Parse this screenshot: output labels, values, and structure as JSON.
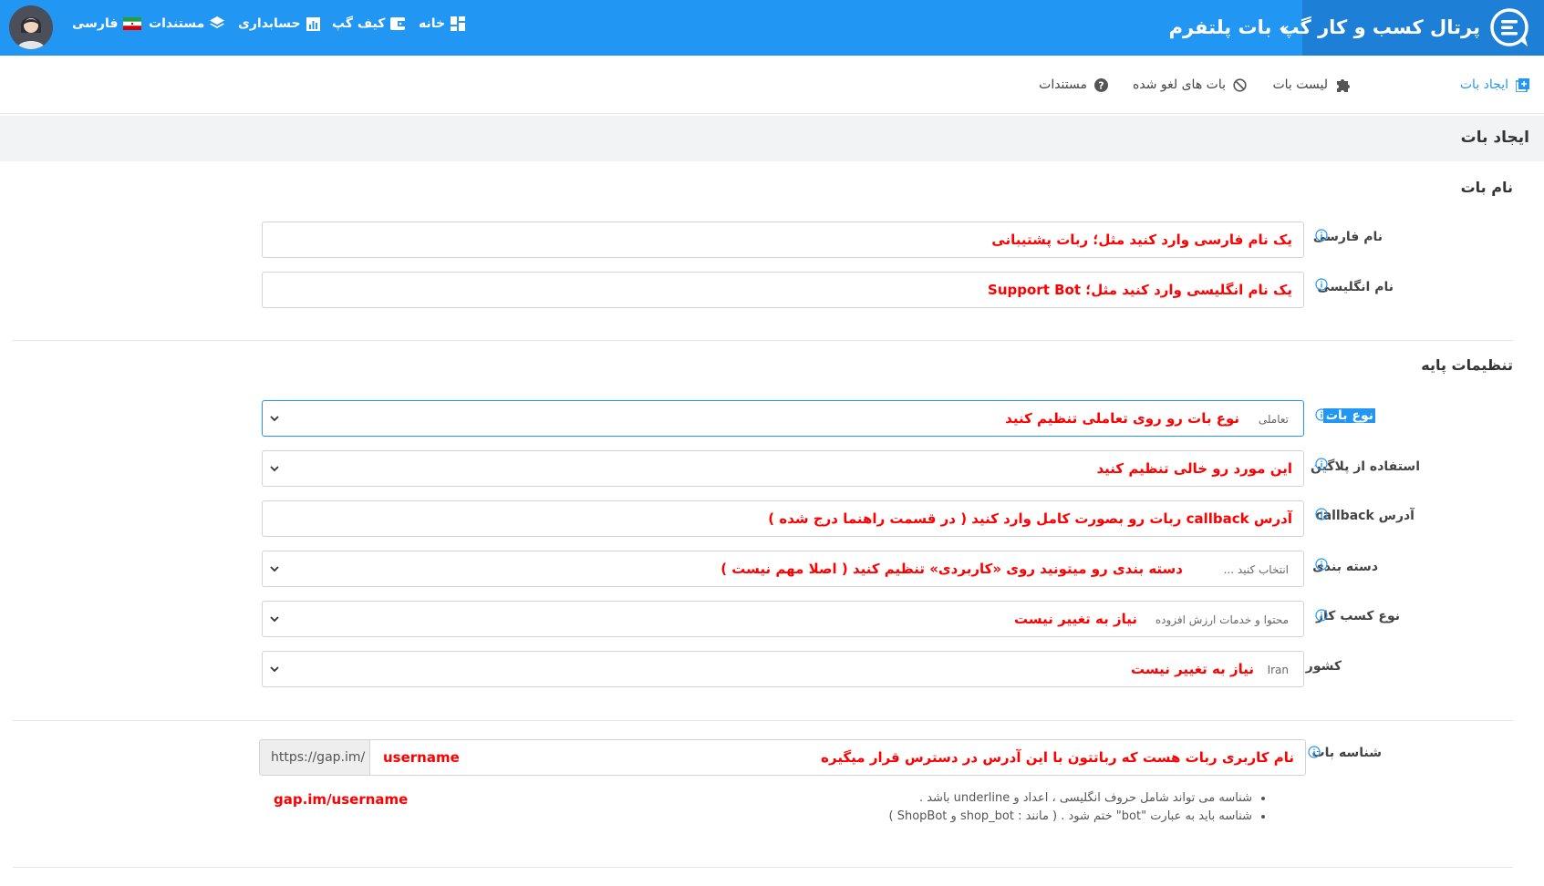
{
  "header": {
    "brand": "پرتال کسب و کار گپ",
    "page_title": "بات پلتفرم",
    "chevron": "»",
    "nav": [
      {
        "label": "خانه",
        "icon": "dashboard-icon"
      },
      {
        "label": "کیف گپ",
        "icon": "wallet-icon"
      },
      {
        "label": "حسابداری",
        "icon": "chart-icon"
      },
      {
        "label": "مستندات",
        "icon": "layers-icon"
      },
      {
        "label": "فارسی",
        "icon": "iran-flag-icon"
      }
    ],
    "accent": "#2196f3"
  },
  "subnav": {
    "tabs": [
      {
        "label": "ایجاد بات",
        "icon": "add-box-icon",
        "active": true
      },
      {
        "label": "لیست بات",
        "icon": "puzzle-icon",
        "active": false
      },
      {
        "label": "بات های لغو شده",
        "icon": "block-icon",
        "active": false
      },
      {
        "label": "مستندات",
        "icon": "help-icon",
        "active": false
      }
    ]
  },
  "section_title": "ایجاد بات",
  "bot_name": {
    "title": "نام بات",
    "persian_label": "نام فارسی",
    "persian_hint": "یک نام فارسی وارد کنید مثل؛ ربات پشتیبانی",
    "english_label": "نام انگلیسی",
    "english_hint": "یک نام انگلیسی وارد کنید مثل؛ Support Bot"
  },
  "basic": {
    "title": "تنظیمات پایه",
    "type_label": "نوع بات",
    "type_value": "تعاملی",
    "type_hint": "نوع بات رو روی  تعاملی تنظیم کنید",
    "plugin_label": "استفاده از پلاگین",
    "plugin_hint": "این مورد رو خالی تنظیم کنید",
    "callback_label": "آدرس callback",
    "callback_hint": "آدرس callback ربات رو بصورت کامل وارد کنید ( در قسمت راهنما درج شده )",
    "category_label": "دسته بندی",
    "category_value": "انتخاب کنید ...",
    "category_hint": "دسته بندی رو میتونید روی «کاربردی» تنظیم کنید ( اصلا مهم نیست )",
    "business_label": "نوع کسب کار",
    "business_value": "محتوا و خدمات ارزش افزوده",
    "business_hint": "نیاز به تغییر نیست",
    "country_label": "کشور",
    "country_value": "Iran",
    "country_hint": "نیاز به تغییر نیست"
  },
  "bot_id": {
    "label": "شناسه بات",
    "prefix": "https://gap.im/",
    "hint_right": "نام کاربری ربات هست که رباتتون با این آدرس در دسترس قرار میگیره",
    "hint_left": "username",
    "rules": [
      "شناسه می تواند شامل حروف انگلیسی ، اعداد و underline باشد .",
      "شناسه باید به عبارت \"bot\" ختم شود . ( مانند : shop_bot و ShopBot )"
    ],
    "example": "gap.im/username"
  }
}
